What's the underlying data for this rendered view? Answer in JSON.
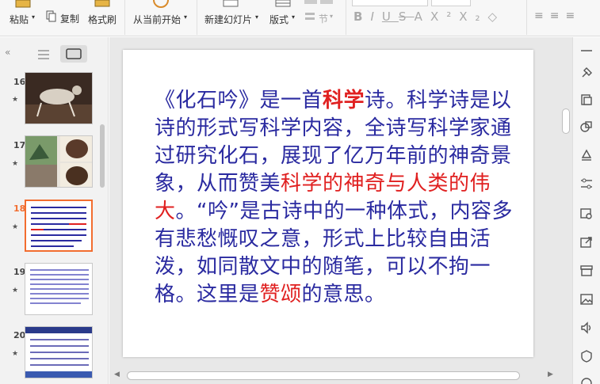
{
  "ribbon": {
    "paste": "粘贴",
    "copy": "复制",
    "format_painter": "格式刷",
    "from_current": "从当前开始",
    "new_slide": "新建幻灯片",
    "layout": "版式",
    "section": "节"
  },
  "thumbnails": [
    {
      "num": "16",
      "star": "★"
    },
    {
      "num": "17",
      "star": "★"
    },
    {
      "num": "18",
      "star": "★"
    },
    {
      "num": "19",
      "star": "★"
    },
    {
      "num": "20",
      "star": "★"
    }
  ],
  "slide": {
    "seg1": "《化石吟》是一首",
    "seg2": "科学",
    "seg3": "诗。科学诗是以诗的形式写科学内容，全诗写科学家通过研究化石，展现了亿万年前的神奇景象，从而赞美",
    "seg4": "科学的神奇与人类的伟大",
    "seg5": "。“吟”是古诗中的一种体式，内容多有悲愁慨叹之意，形式上比较自由活泼，如同散文中的随笔，可以不拘一格。这里是",
    "seg6": "赞颂",
    "seg7": "的意思。"
  },
  "colors": {
    "body_text": "#2a2aa0",
    "highlight": "#e02020",
    "selected_thumb_border": "#f26d2f"
  }
}
